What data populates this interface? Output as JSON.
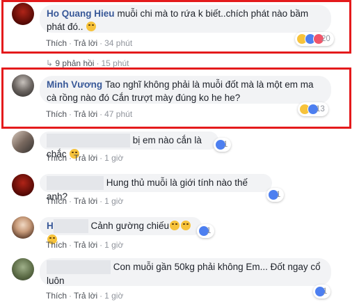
{
  "comments": [
    {
      "author": "Ho Quang Hieu",
      "text": "muỗi chi mà to rứa k biết..chích phát nào bầm phát đó..",
      "reaction_count": "20",
      "reply_count_label": "9 phản hồi",
      "reply_time": "15 phút",
      "time": "34 phút",
      "reactions": [
        "haha",
        "like",
        "love"
      ]
    },
    {
      "author": "Minh Vương",
      "text": "Tao nghĩ không phải là muỗi đốt mà là một em ma cà rồng nào đó Cắn trượt mày đúng ko he he?",
      "reaction_count": "13",
      "time": "47 phút",
      "reactions": [
        "haha",
        "like"
      ]
    },
    {
      "author": "",
      "text": "bị em nào cắn là chắc",
      "reaction_count": "1",
      "time": "1 giờ",
      "reactions": [
        "like"
      ]
    },
    {
      "author": "",
      "text": "Hung thủ muỗi là giới tính nào thế anh?",
      "reaction_count": "1",
      "time": "1 giờ",
      "reactions": [
        "like"
      ]
    },
    {
      "author": "H",
      "text": "Cảnh gường chiếu",
      "reaction_count": "1",
      "time": "1 giờ",
      "reactions": [
        "like"
      ]
    },
    {
      "author": "",
      "text": "Con muỗi gần 50kg phải không Em... Đốt ngay cổ luôn",
      "reaction_count": "1",
      "time": "1 giờ",
      "reactions": [
        "like"
      ]
    }
  ],
  "actions": {
    "like": "Thích",
    "reply": "Trả lời",
    "separator": "·"
  },
  "colors": {
    "highlight": "#e41a1c",
    "link": "#385898",
    "bubble": "#f2f3f5"
  }
}
